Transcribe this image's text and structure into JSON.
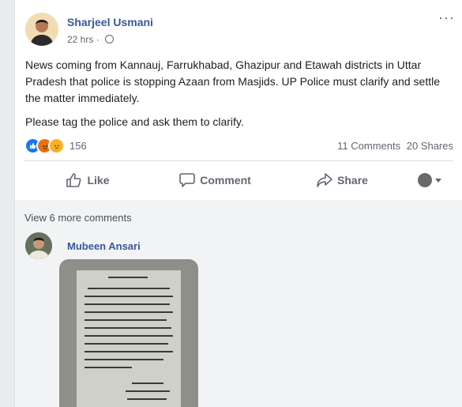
{
  "post": {
    "author": "Sharjeel Usmani",
    "time": "22 hrs",
    "separator": "·",
    "more": "···",
    "text": "News coming from Kannauj, Farrukhabad, Ghazipur and Etawah districts in Uttar Pradesh that police is stopping Azaan from Masjids. UP Police must clarify and settle the matter immediately.",
    "text2": "Please tag the police and ask them to clarify."
  },
  "reactions": {
    "icons": [
      "like-icon",
      "angry-icon",
      "sad-icon"
    ],
    "count": "156",
    "comments": "11 Comments",
    "shares": "20 Shares"
  },
  "actions": {
    "like": "Like",
    "comment": "Comment",
    "share": "Share"
  },
  "comments": {
    "view_more": "View 6 more comments",
    "commenter": "Mubeen Ansari"
  },
  "colors": {
    "link": "#365899",
    "like": "#1877f2",
    "angry": "#e9710f",
    "sad": "#f7b125"
  }
}
